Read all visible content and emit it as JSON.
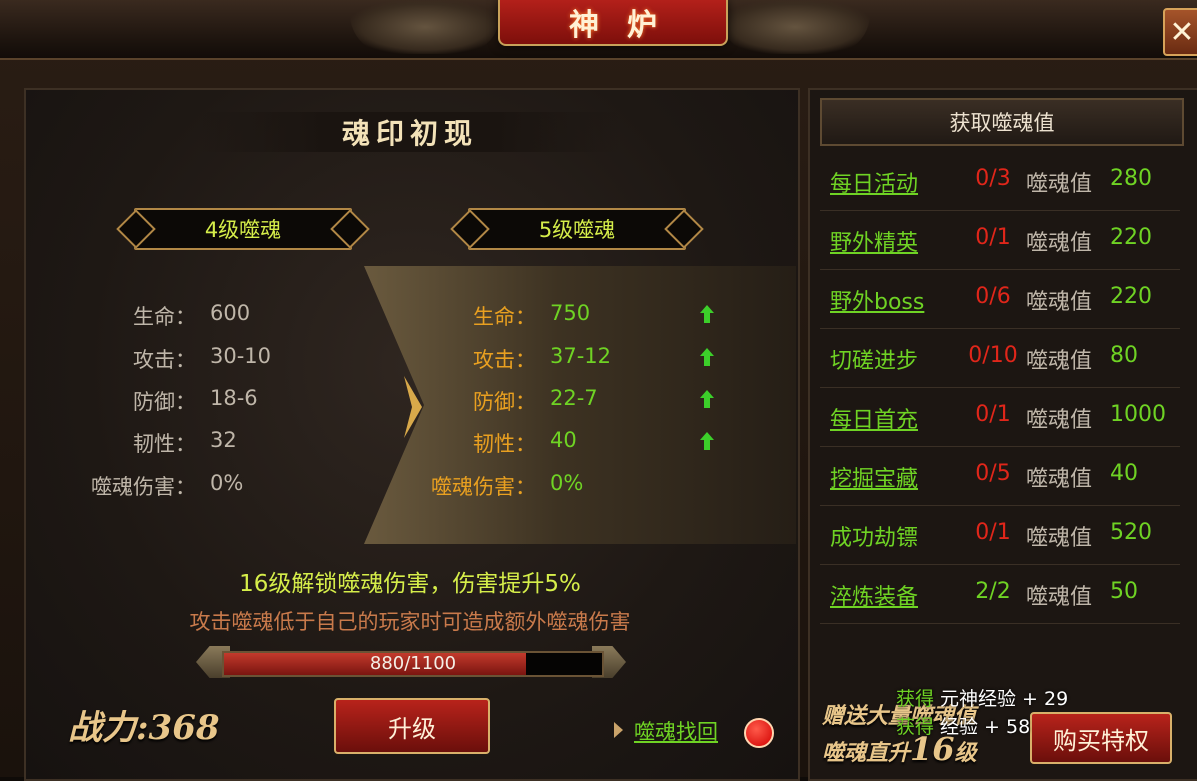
{
  "window": {
    "title": "神炉",
    "close_label": "✕"
  },
  "left": {
    "section_title": "魂印初现",
    "current_level": "4级噬魂",
    "next_level": "5级噬魂",
    "current_stats": [
      {
        "label": "生命：",
        "value": "600"
      },
      {
        "label": "攻击：",
        "value": "30-10"
      },
      {
        "label": "防御：",
        "value": "18-6"
      },
      {
        "label": "韧性：",
        "value": "32"
      },
      {
        "label": "噬魂伤害：",
        "value": "0%"
      }
    ],
    "next_stats": [
      {
        "label": "生命：",
        "value": "750",
        "up": true
      },
      {
        "label": "攻击：",
        "value": "37-12",
        "up": true
      },
      {
        "label": "防御：",
        "value": "22-7",
        "up": true
      },
      {
        "label": "韧性：",
        "value": "40",
        "up": true
      },
      {
        "label": "噬魂伤害：",
        "value": "0%",
        "up": false
      }
    ],
    "unlock_text": "16级解锁噬魂伤害，伤害提升5%",
    "desc_text": "攻击噬魂低于自己的玩家时可造成额外噬魂伤害",
    "progress": {
      "text": "880/1100",
      "current": 880,
      "max": 1100
    },
    "power": "战力:368",
    "upgrade_label": "升级",
    "recover_label": "噬魂找回"
  },
  "right": {
    "header": "获取噬魂值",
    "unit_label": "噬魂值",
    "tasks": [
      {
        "name": "每日活动",
        "count": "0/3",
        "value": "280",
        "underline": true,
        "count_color": "#e0261a"
      },
      {
        "name": "野外精英",
        "count": "0/1",
        "value": "220",
        "underline": true,
        "count_color": "#e0261a"
      },
      {
        "name": "野外boss",
        "count": "0/6",
        "value": "220",
        "underline": true,
        "count_color": "#e0261a"
      },
      {
        "name": "切磋进步",
        "count": "0/10",
        "value": "80",
        "underline": false,
        "count_color": "#e0261a"
      },
      {
        "name": "每日首充",
        "count": "0/1",
        "value": "1000",
        "underline": true,
        "count_color": "#e0261a"
      },
      {
        "name": "挖掘宝藏",
        "count": "0/5",
        "value": "40",
        "underline": true,
        "count_color": "#e0261a"
      },
      {
        "name": "成功劫镖",
        "count": "0/1",
        "value": "520",
        "underline": false,
        "count_color": "#e0261a"
      },
      {
        "name": "淬炼装备",
        "count": "2/2",
        "value": "50",
        "underline": true,
        "count_color": "#6fd324"
      }
    ],
    "promo_line1": "赠送大量噬魂值",
    "promo_line2_a": "噬魂直升",
    "promo_line2_num": "16",
    "promo_line2_b": "级",
    "buy_label": "购买特权",
    "toasts": [
      {
        "key": "获得",
        "text": "元神经验 + 29"
      },
      {
        "key": "获得",
        "text": "经验 + 58"
      }
    ]
  },
  "colors": {
    "green": "#6fd324",
    "orange": "#e9a020",
    "red": "#e0261a",
    "gold": "#b28846"
  }
}
